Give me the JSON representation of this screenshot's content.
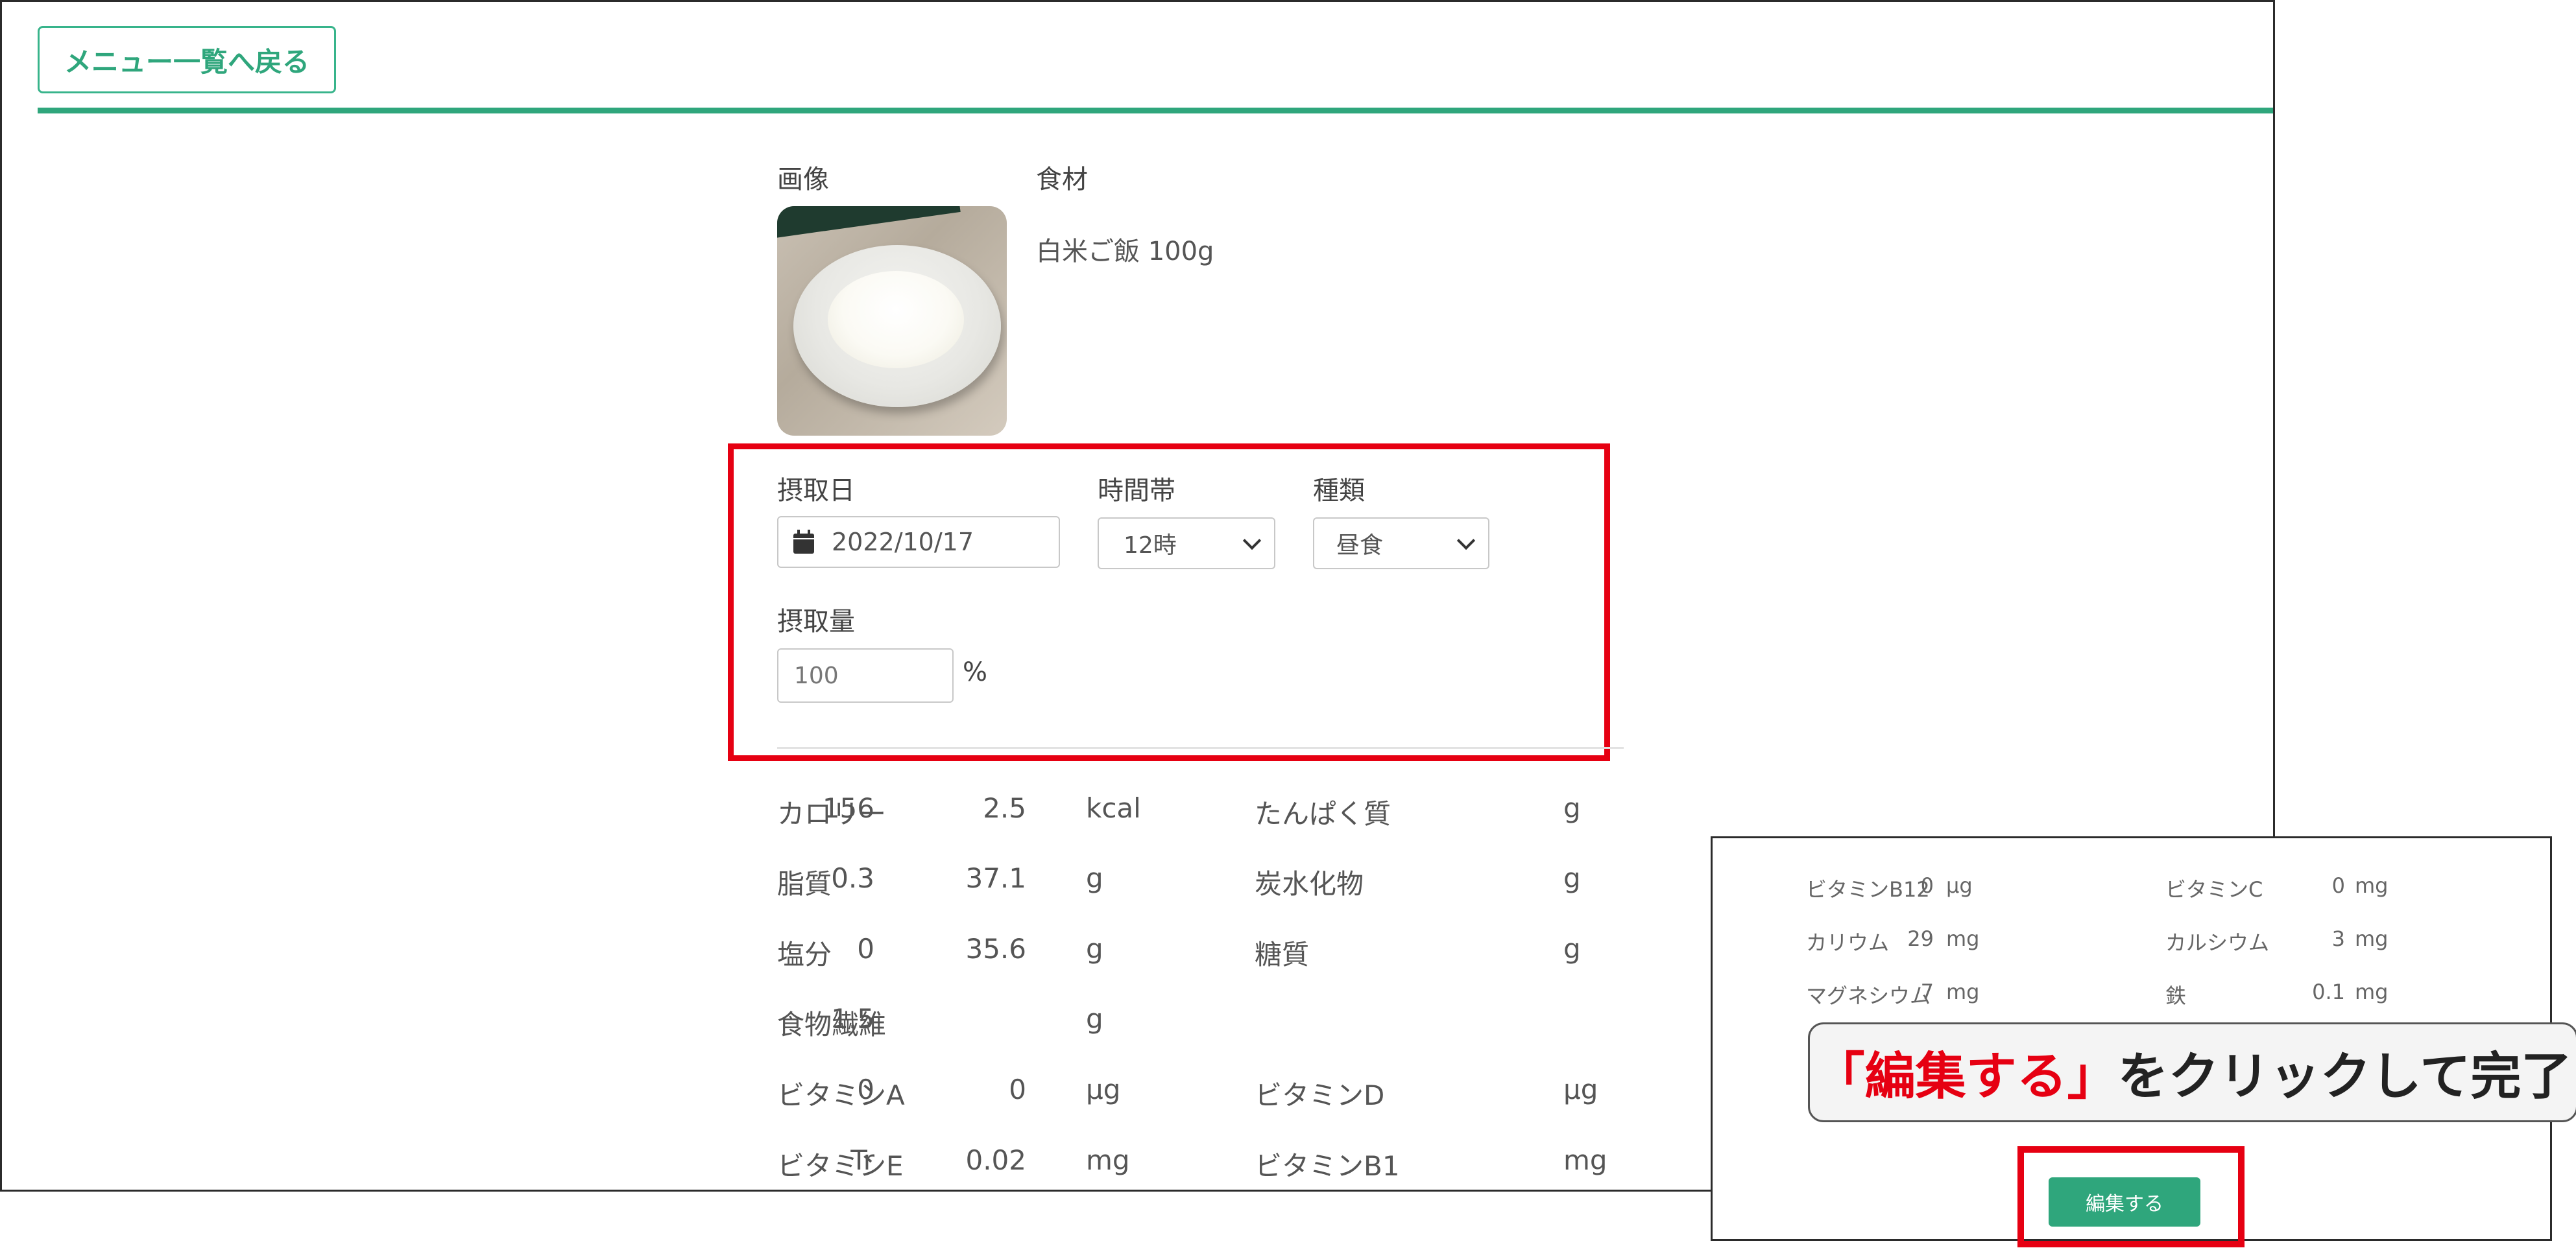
{
  "header": {
    "back_label": "メニュー一覧へ戻る"
  },
  "columns": {
    "image_label": "画像",
    "ingredient_label": "食材",
    "ingredient_value": "白米ご飯 100g"
  },
  "form": {
    "date_label": "摂取日",
    "date_value": "2022/10/17",
    "time_label": "時間帯",
    "time_value": "12時",
    "type_label": "種類",
    "type_value": "昼食",
    "amount_label": "摂取量",
    "amount_value": "100",
    "amount_unit": "%"
  },
  "nutrition": [
    {
      "name": "カロリー",
      "value": "156",
      "unit": "kcal",
      "name2": "たんぱく質",
      "value2": "2.5",
      "unit2": "g"
    },
    {
      "name": "脂質",
      "value": "0.3",
      "unit": "g",
      "name2": "炭水化物",
      "value2": "37.1",
      "unit2": "g"
    },
    {
      "name": "塩分",
      "value": "0",
      "unit": "g",
      "name2": "糖質",
      "value2": "35.6",
      "unit2": "g"
    },
    {
      "name": "食物繊維",
      "value": "1.5",
      "unit": "g",
      "name2": "",
      "value2": "",
      "unit2": ""
    },
    {
      "name": "ビタミンA",
      "value": "0",
      "unit": "μg",
      "name2": "ビタミンD",
      "value2": "0",
      "unit2": "μg"
    },
    {
      "name": "ビタミンE",
      "value": "Tr",
      "unit": "mg",
      "name2": "ビタミンB1",
      "value2": "0.02",
      "unit2": "mg"
    }
  ],
  "inset": {
    "rows": [
      {
        "name": "ビタミンB12",
        "value": "0",
        "unit": "μg",
        "name2": "ビタミンC",
        "value2": "0",
        "unit2": "mg"
      },
      {
        "name": "カリウム",
        "value": "29",
        "unit": "mg",
        "name2": "カルシウム",
        "value2": "3",
        "unit2": "mg"
      },
      {
        "name": "マグネシウム",
        "value": "7",
        "unit": "mg",
        "name2": "鉄",
        "value2": "0.1",
        "unit2": "mg"
      }
    ],
    "callout_red": "「編集する」",
    "callout_rest": "をクリックして完了",
    "edit_label": "編集する"
  },
  "colors": {
    "accent": "#2fa67c",
    "highlight": "#e60012"
  },
  "icons": {
    "date": "calendar-icon",
    "select": "chevron-down-icon"
  }
}
